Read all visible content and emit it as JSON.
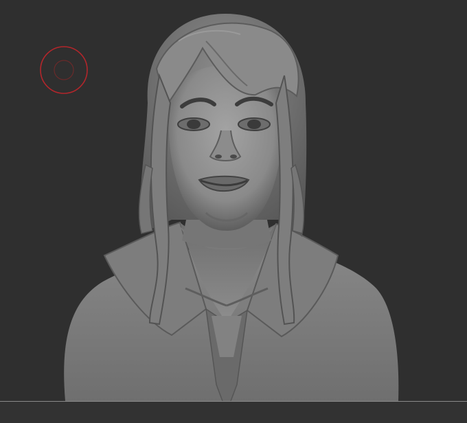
{
  "viewport": {
    "background_color": "#2f2f2f",
    "model": "sculpted-bust",
    "model_material_color": "#8f8f8f"
  },
  "brush_cursor": {
    "icon": "brush-cursor-icon",
    "color": "#b3262b"
  }
}
